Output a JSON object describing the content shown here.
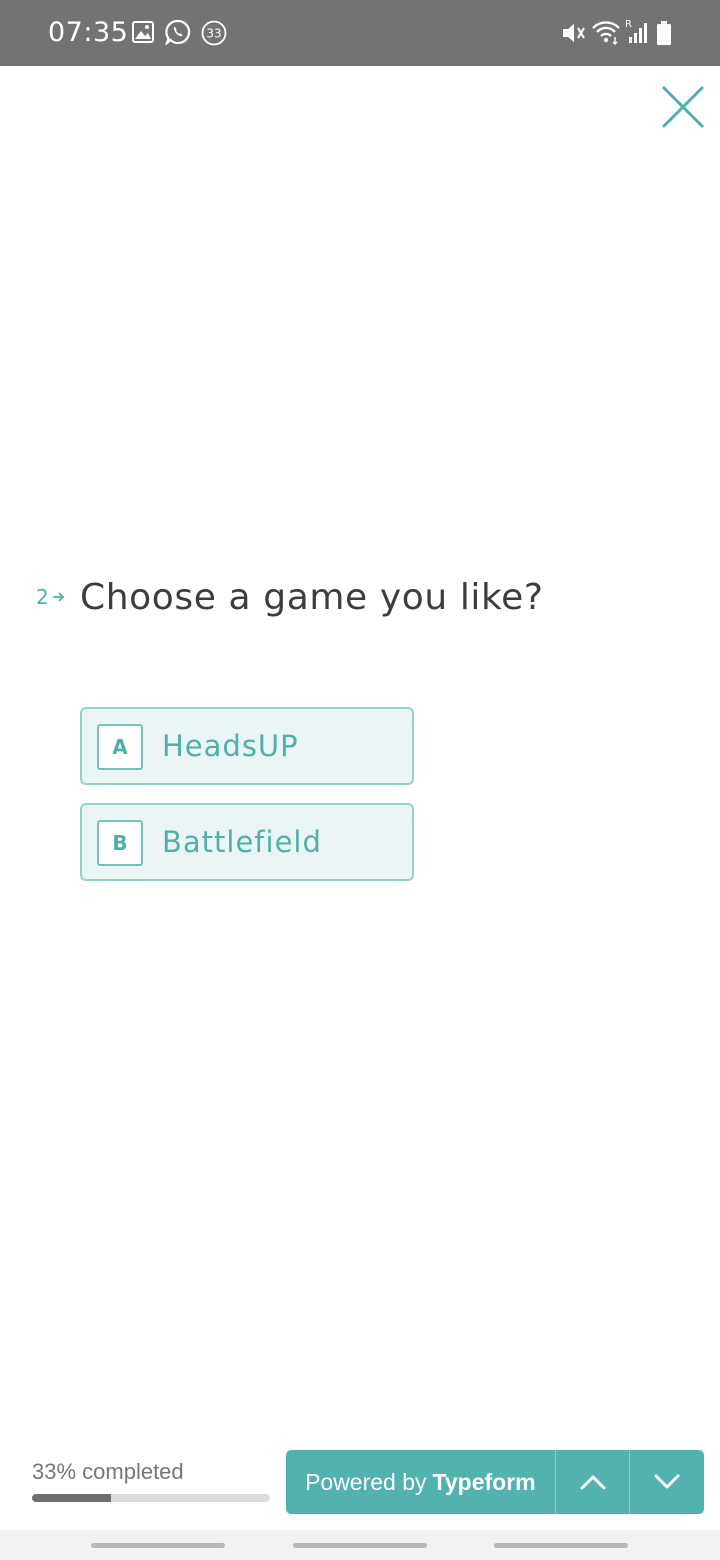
{
  "status_bar": {
    "time": "07:35",
    "notification_count": "33",
    "icons": [
      "gallery-icon",
      "whatsapp-icon",
      "notification-count-icon",
      "mute-icon",
      "wifi-icon",
      "signal-icon",
      "battery-icon"
    ]
  },
  "form": {
    "question_number": "2",
    "question_text": "Choose a game you like?",
    "options": [
      {
        "key": "A",
        "label": "HeadsUP"
      },
      {
        "key": "B",
        "label": "Battlefield"
      }
    ]
  },
  "progress": {
    "text": "33% completed",
    "percent": 33
  },
  "footer": {
    "powered_prefix": "Powered by",
    "powered_brand": "Typeform"
  },
  "colors": {
    "accent": "#52b2ad",
    "option_bg": "#ebf5f5",
    "option_border": "#93cfcb",
    "question_text": "#3d3d3d",
    "status_bar": "#737373"
  }
}
